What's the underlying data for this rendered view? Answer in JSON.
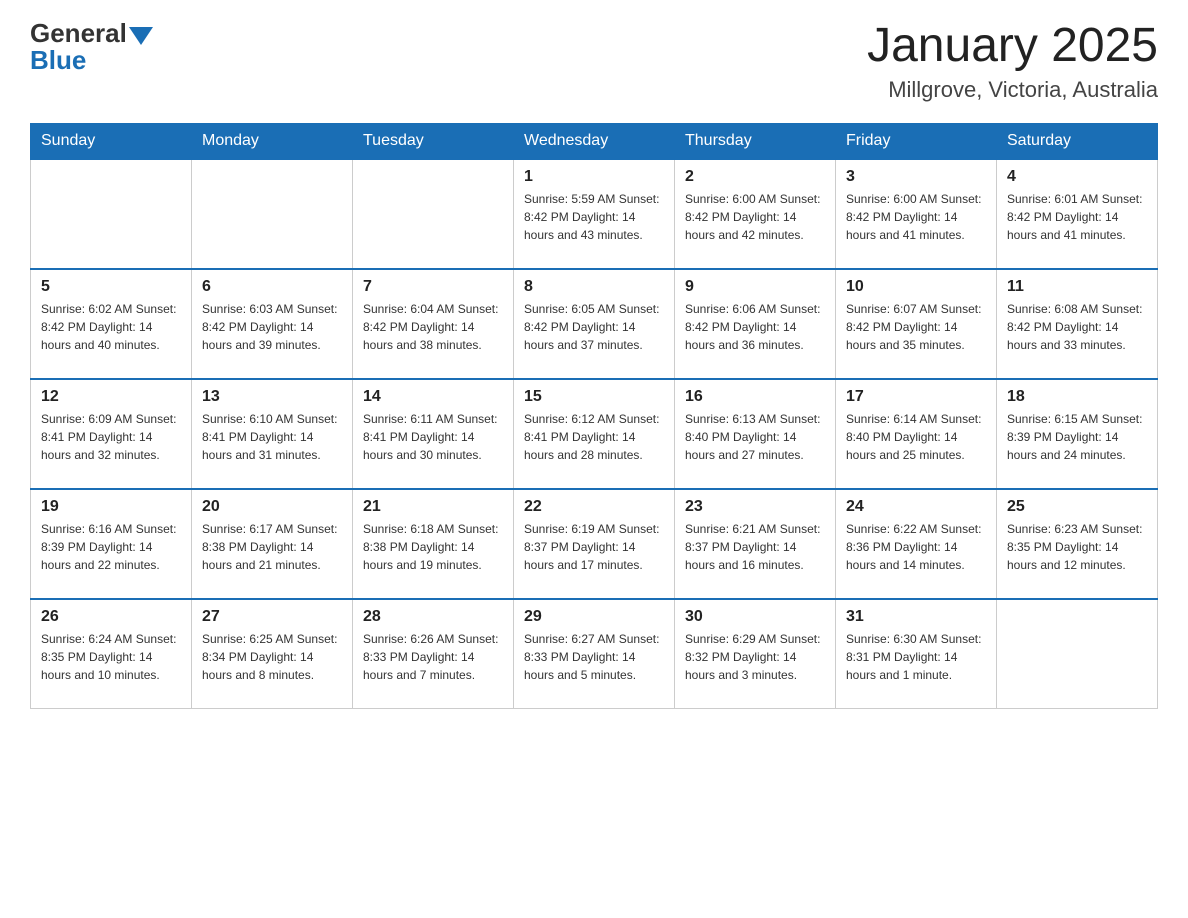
{
  "header": {
    "logo_general": "General",
    "logo_blue": "Blue",
    "month_title": "January 2025",
    "location": "Millgrove, Victoria, Australia"
  },
  "days_of_week": [
    "Sunday",
    "Monday",
    "Tuesday",
    "Wednesday",
    "Thursday",
    "Friday",
    "Saturday"
  ],
  "weeks": [
    [
      {
        "day": "",
        "info": ""
      },
      {
        "day": "",
        "info": ""
      },
      {
        "day": "",
        "info": ""
      },
      {
        "day": "1",
        "info": "Sunrise: 5:59 AM\nSunset: 8:42 PM\nDaylight: 14 hours\nand 43 minutes."
      },
      {
        "day": "2",
        "info": "Sunrise: 6:00 AM\nSunset: 8:42 PM\nDaylight: 14 hours\nand 42 minutes."
      },
      {
        "day": "3",
        "info": "Sunrise: 6:00 AM\nSunset: 8:42 PM\nDaylight: 14 hours\nand 41 minutes."
      },
      {
        "day": "4",
        "info": "Sunrise: 6:01 AM\nSunset: 8:42 PM\nDaylight: 14 hours\nand 41 minutes."
      }
    ],
    [
      {
        "day": "5",
        "info": "Sunrise: 6:02 AM\nSunset: 8:42 PM\nDaylight: 14 hours\nand 40 minutes."
      },
      {
        "day": "6",
        "info": "Sunrise: 6:03 AM\nSunset: 8:42 PM\nDaylight: 14 hours\nand 39 minutes."
      },
      {
        "day": "7",
        "info": "Sunrise: 6:04 AM\nSunset: 8:42 PM\nDaylight: 14 hours\nand 38 minutes."
      },
      {
        "day": "8",
        "info": "Sunrise: 6:05 AM\nSunset: 8:42 PM\nDaylight: 14 hours\nand 37 minutes."
      },
      {
        "day": "9",
        "info": "Sunrise: 6:06 AM\nSunset: 8:42 PM\nDaylight: 14 hours\nand 36 minutes."
      },
      {
        "day": "10",
        "info": "Sunrise: 6:07 AM\nSunset: 8:42 PM\nDaylight: 14 hours\nand 35 minutes."
      },
      {
        "day": "11",
        "info": "Sunrise: 6:08 AM\nSunset: 8:42 PM\nDaylight: 14 hours\nand 33 minutes."
      }
    ],
    [
      {
        "day": "12",
        "info": "Sunrise: 6:09 AM\nSunset: 8:41 PM\nDaylight: 14 hours\nand 32 minutes."
      },
      {
        "day": "13",
        "info": "Sunrise: 6:10 AM\nSunset: 8:41 PM\nDaylight: 14 hours\nand 31 minutes."
      },
      {
        "day": "14",
        "info": "Sunrise: 6:11 AM\nSunset: 8:41 PM\nDaylight: 14 hours\nand 30 minutes."
      },
      {
        "day": "15",
        "info": "Sunrise: 6:12 AM\nSunset: 8:41 PM\nDaylight: 14 hours\nand 28 minutes."
      },
      {
        "day": "16",
        "info": "Sunrise: 6:13 AM\nSunset: 8:40 PM\nDaylight: 14 hours\nand 27 minutes."
      },
      {
        "day": "17",
        "info": "Sunrise: 6:14 AM\nSunset: 8:40 PM\nDaylight: 14 hours\nand 25 minutes."
      },
      {
        "day": "18",
        "info": "Sunrise: 6:15 AM\nSunset: 8:39 PM\nDaylight: 14 hours\nand 24 minutes."
      }
    ],
    [
      {
        "day": "19",
        "info": "Sunrise: 6:16 AM\nSunset: 8:39 PM\nDaylight: 14 hours\nand 22 minutes."
      },
      {
        "day": "20",
        "info": "Sunrise: 6:17 AM\nSunset: 8:38 PM\nDaylight: 14 hours\nand 21 minutes."
      },
      {
        "day": "21",
        "info": "Sunrise: 6:18 AM\nSunset: 8:38 PM\nDaylight: 14 hours\nand 19 minutes."
      },
      {
        "day": "22",
        "info": "Sunrise: 6:19 AM\nSunset: 8:37 PM\nDaylight: 14 hours\nand 17 minutes."
      },
      {
        "day": "23",
        "info": "Sunrise: 6:21 AM\nSunset: 8:37 PM\nDaylight: 14 hours\nand 16 minutes."
      },
      {
        "day": "24",
        "info": "Sunrise: 6:22 AM\nSunset: 8:36 PM\nDaylight: 14 hours\nand 14 minutes."
      },
      {
        "day": "25",
        "info": "Sunrise: 6:23 AM\nSunset: 8:35 PM\nDaylight: 14 hours\nand 12 minutes."
      }
    ],
    [
      {
        "day": "26",
        "info": "Sunrise: 6:24 AM\nSunset: 8:35 PM\nDaylight: 14 hours\nand 10 minutes."
      },
      {
        "day": "27",
        "info": "Sunrise: 6:25 AM\nSunset: 8:34 PM\nDaylight: 14 hours\nand 8 minutes."
      },
      {
        "day": "28",
        "info": "Sunrise: 6:26 AM\nSunset: 8:33 PM\nDaylight: 14 hours\nand 7 minutes."
      },
      {
        "day": "29",
        "info": "Sunrise: 6:27 AM\nSunset: 8:33 PM\nDaylight: 14 hours\nand 5 minutes."
      },
      {
        "day": "30",
        "info": "Sunrise: 6:29 AM\nSunset: 8:32 PM\nDaylight: 14 hours\nand 3 minutes."
      },
      {
        "day": "31",
        "info": "Sunrise: 6:30 AM\nSunset: 8:31 PM\nDaylight: 14 hours\nand 1 minute."
      },
      {
        "day": "",
        "info": ""
      }
    ]
  ]
}
